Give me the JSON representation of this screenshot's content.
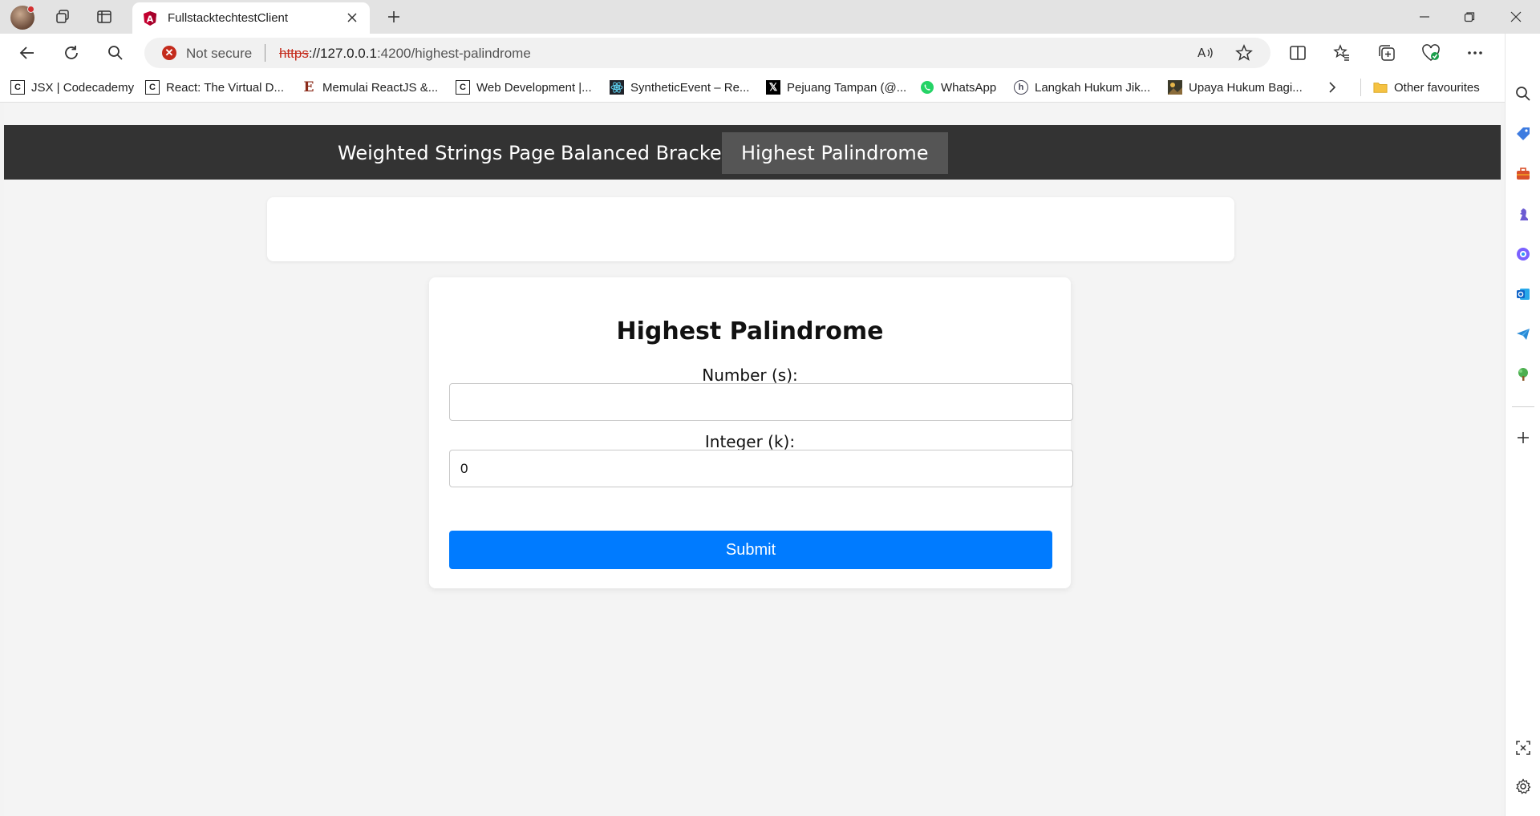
{
  "browser": {
    "tab_title": "FullstacktechtestClient",
    "security_label": "Not secure",
    "url_scheme": "https",
    "url_host": "://127.0.0.1",
    "url_rest": ":4200/highest-palindrome"
  },
  "bookmarks": [
    {
      "label": "JSX | Codecademy",
      "icon": "codecademy-icon"
    },
    {
      "label": "React: The Virtual D...",
      "icon": "codecademy-icon"
    },
    {
      "label": "Memulai ReactJS &...",
      "icon": "e-logo-icon"
    },
    {
      "label": "Web Development |...",
      "icon": "codecademy-icon"
    },
    {
      "label": "SyntheticEvent – Re...",
      "icon": "react-icon"
    },
    {
      "label": "Pejuang Tampan (@...",
      "icon": "x-icon"
    },
    {
      "label": "WhatsApp",
      "icon": "whatsapp-icon"
    },
    {
      "label": "Langkah Hukum Jik...",
      "icon": "h-logo-icon"
    },
    {
      "label": "Upaya Hukum Bagi...",
      "icon": "image-icon"
    },
    {
      "label": "Other favourites",
      "icon": "folder-icon"
    }
  ],
  "app": {
    "nav": [
      "Weighted Strings Page",
      "Balanced Bracket",
      "Highest Palindrome"
    ],
    "active_nav": "Highest Palindrome",
    "form": {
      "title": "Highest Palindrome",
      "number_label": "Number (s):",
      "number_value": "",
      "integer_label": "Integer (k):",
      "integer_value": "0",
      "submit_label": "Submit"
    }
  },
  "colors": {
    "navbar": "#333333",
    "nav_active": "#555555",
    "submit_button": "#007bff",
    "page_background": "#f4f4f4"
  }
}
